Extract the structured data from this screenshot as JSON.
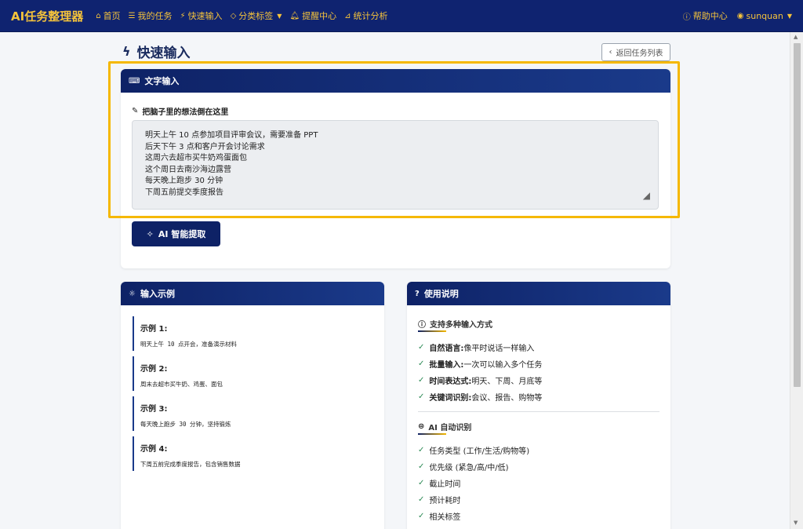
{
  "navbar": {
    "brand": "AI任务整理器",
    "items": [
      {
        "icon": "home-icon",
        "glyph": "⌂",
        "label": "首页"
      },
      {
        "icon": "list-icon",
        "glyph": "☰",
        "label": "我的任务"
      },
      {
        "icon": "bolt-icon",
        "glyph": "⚡",
        "label": "快速输入"
      },
      {
        "icon": "tag-icon",
        "glyph": "◇",
        "label": "分类标签"
      },
      {
        "icon": "bell-icon",
        "glyph": "♫",
        "label": "提醒中心"
      },
      {
        "icon": "chart-icon",
        "glyph": "⊿",
        "label": "统计分析"
      }
    ],
    "help_label": "帮助中心",
    "user_label": "sunquan"
  },
  "page": {
    "title": "快速输入",
    "back_label": "返回任务列表"
  },
  "text_input": {
    "header": "文字输入",
    "field_label": "把脑子里的想法倒在这里",
    "lines": [
      "明天上午 10 点参加项目评审会议，需要准备 PPT",
      "后天下午 3 点和客户开会讨论需求",
      "这周六去超市买牛奶鸡蛋面包",
      "这个周日去南沙海边露营",
      "每天晚上跑步 30 分钟",
      "下周五前提交季度报告"
    ],
    "button_label": "AI 智能提取"
  },
  "examples": {
    "header": "输入示例",
    "items": [
      {
        "title": "示例 1:",
        "text": "明天上午 10 点开会，准备演示材料"
      },
      {
        "title": "示例 2:",
        "text": "周末去超市买牛奶、鸡蛋、面包"
      },
      {
        "title": "示例 3:",
        "text": "每天晚上跑步 30 分钟，坚持锻炼"
      },
      {
        "title": "示例 4:",
        "text": "下周五前完成季度报告，包含销售数据"
      }
    ]
  },
  "help": {
    "header": "使用说明",
    "section1_title": "支持多种输入方式",
    "section1_items": [
      {
        "bold": "自然语言:",
        "text": "像平时说话一样输入"
      },
      {
        "bold": "批量输入:",
        "text": "一次可以输入多个任务"
      },
      {
        "bold": "时间表达式:",
        "text": "明天、下周、月底等"
      },
      {
        "bold": "关键词识别:",
        "text": "会议、报告、购物等"
      }
    ],
    "section2_title": "AI 自动识别",
    "section2_items": [
      "任务类型 (工作/生活/购物等)",
      "优先级 (紧急/高/中/低)",
      "截止时间",
      "预计耗时",
      "相关标签"
    ]
  },
  "colors": {
    "navbar": "#0f2370",
    "brand": "#f5c33b",
    "highlight": "#f5b800",
    "check": "#2e8b57"
  }
}
